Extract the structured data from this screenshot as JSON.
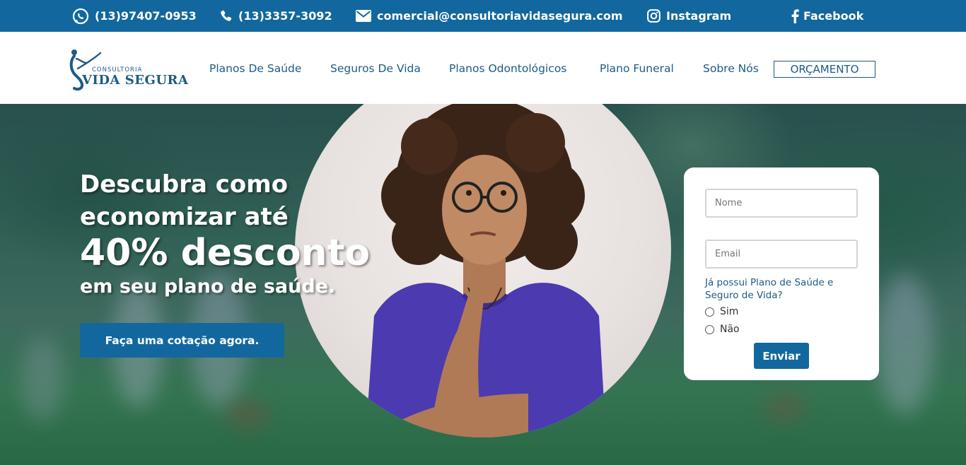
{
  "topbar": {
    "whatsapp": {
      "icon": "whatsapp-icon",
      "label": "(13)97407-0953"
    },
    "phone": {
      "icon": "phone-icon",
      "label": "(13)3357-3092"
    },
    "email": {
      "icon": "envelope-icon",
      "label": "comercial@consultoriavidasegura.com"
    },
    "instagram": {
      "icon": "instagram-icon",
      "label": "Instagram"
    },
    "facebook": {
      "icon": "facebook-icon",
      "label": "Facebook"
    }
  },
  "brand": {
    "top": "CONSULTORIA",
    "name": "VIDA SEGURA"
  },
  "nav": {
    "items": [
      {
        "label": "Planos De Saúde"
      },
      {
        "label": "Seguros De Vida"
      },
      {
        "label": "Planos Odontológicos"
      },
      {
        "label": "Plano Funeral"
      },
      {
        "label": "Sobre Nós"
      }
    ],
    "cta_label": "ORÇAMENTO"
  },
  "hero": {
    "line1": "Descubra como",
    "line2": "economizar até",
    "line3": "40% desconto",
    "line4": "em seu plano de saúde.",
    "cta": "Faça uma cotação agora."
  },
  "form": {
    "name_placeholder": "Nome",
    "email_placeholder": "Email",
    "question": "Já possui Plano de Saúde e Seguro de Vida?",
    "options": [
      "Sim",
      "Não"
    ],
    "submit": "Enviar"
  },
  "colors": {
    "primary": "#12689e",
    "nav_text": "#1c5b86",
    "white": "#ffffff"
  }
}
